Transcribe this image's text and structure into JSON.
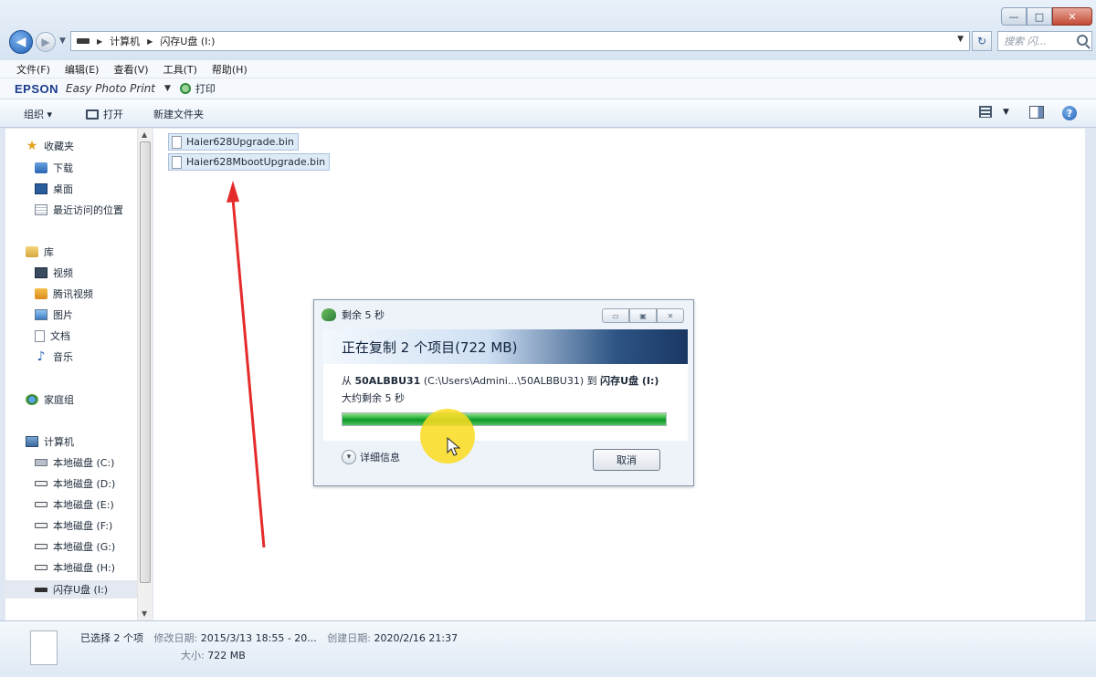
{
  "window": {
    "controls": [
      "—",
      "□",
      "✕"
    ]
  },
  "address_bar": {
    "crumbs": [
      "计算机",
      "闪存U盘 (I:)"
    ],
    "search_placeholder": "搜索 闪..."
  },
  "menu": [
    "文件(F)",
    "编辑(E)",
    "查看(V)",
    "工具(T)",
    "帮助(H)"
  ],
  "epson_bar": {
    "brand": "EPSON",
    "product": "Easy Photo Print",
    "print_label": "打印"
  },
  "toolbar": {
    "organize": "组织 ▾",
    "open": "打开",
    "new_folder": "新建文件夹"
  },
  "nav": {
    "favorites": "收藏夹",
    "downloads": "下载",
    "desktop": "桌面",
    "recent": "最近访问的位置",
    "libraries": "库",
    "videos": "视频",
    "tv": "腾讯视频",
    "pictures": "图片",
    "documents": "文档",
    "music": "音乐",
    "homegroup": "家庭组",
    "computer": "计算机",
    "drive_c": "本地磁盘 (C:)",
    "drive_d": "本地磁盘 (D:)",
    "drive_e": "本地磁盘 (E:)",
    "drive_f": "本地磁盘 (F:)",
    "drive_g": "本地磁盘 (G:)",
    "drive_h": "本地磁盘 (H:)",
    "drive_i": "闪存U盘 (I:)"
  },
  "files": [
    "Haier628Upgrade.bin",
    "Haier628MbootUpgrade.bin"
  ],
  "copy_dialog": {
    "title": "剩余 5 秒",
    "header": "正在复制 2 个项目(722 MB)",
    "from_prefix": "从",
    "from_name": "50ALBBU31",
    "from_path": "(C:\\Users\\Admini...\\50ALBBU31)",
    "to_prefix": "到",
    "to_name": "闪存U盘 (I:)",
    "remaining": "大约剩余 5 秒",
    "progress": 1.0,
    "details": "详细信息",
    "cancel": "取消"
  },
  "details_pane": {
    "selected": "已选择 2 个项",
    "modified_label": "修改日期:",
    "modified_value": "2015/3/13 18:55 - 20...",
    "created_label": "创建日期:",
    "created_value": "2020/2/16 21:37",
    "size_label": "大小:",
    "size_value": "722 MB"
  },
  "colors": {
    "progress": "#1eae36",
    "annotation_arrow": "#e52b2b",
    "cursor_highlight": "#fadc1e"
  }
}
